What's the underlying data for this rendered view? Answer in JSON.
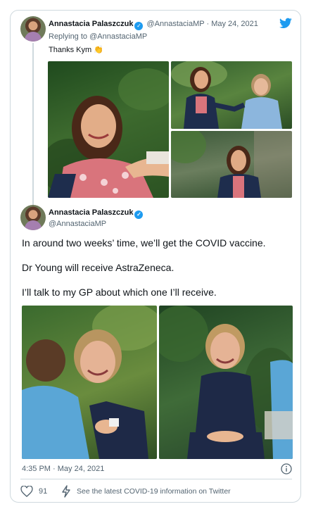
{
  "reply_tweet": {
    "author_name": "Annastacia Palaszczuk",
    "handle": "@AnnastaciaMP",
    "separator": "·",
    "date": "May 24, 2021",
    "replying_prefix": "Replying to",
    "replying_to": "@AnnastaciaMP",
    "text": "Thanks Kym",
    "emoji": "👏"
  },
  "main_tweet": {
    "author_name": "Annastacia Palaszczuk",
    "handle": "@AnnastaciaMP",
    "lines": [
      "In around two weeks’ time, we’ll get the COVID vaccine.",
      "Dr Young will receive AstraZeneca.",
      "I’ll talk to my GP about which one I’ll receive."
    ],
    "timestamp": "4:35 PM · May 24, 2021",
    "like_count": "91",
    "info_link": "See the latest COVID-19 information on Twitter"
  },
  "icons": {
    "brand": "twitter-bird-icon",
    "verified": "verified-badge-icon",
    "info": "info-icon",
    "like": "heart-icon",
    "covid": "lightning-icon"
  },
  "colors": {
    "brand_blue": "#1d9bf0",
    "text": "#0f1419",
    "muted": "#536471",
    "border": "#cfd9de"
  }
}
